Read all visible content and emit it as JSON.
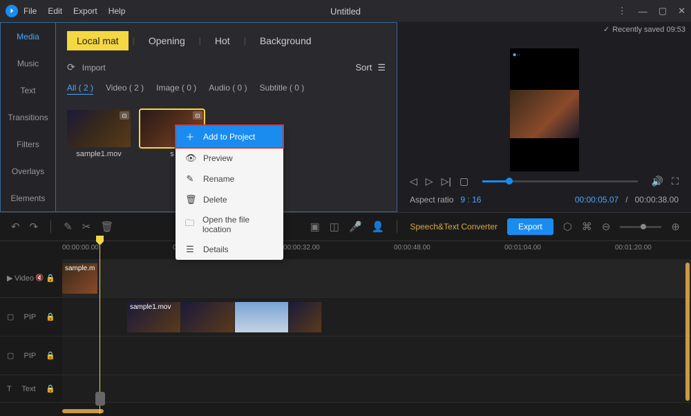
{
  "app": {
    "title": "Untitled",
    "menus": [
      "File",
      "Edit",
      "Export",
      "Help"
    ]
  },
  "status": {
    "saved": "Recently saved 09:53"
  },
  "sidebar": {
    "items": [
      "Media",
      "Music",
      "Text",
      "Transitions",
      "Filters",
      "Overlays",
      "Elements"
    ]
  },
  "tabs": {
    "local": "Local mat",
    "opening": "Opening",
    "hot": "Hot",
    "background": "Background"
  },
  "import": {
    "label": "Import",
    "sort": "Sort"
  },
  "filters": {
    "all": "All ( 2 )",
    "video": "Video ( 2 )",
    "image": "Image ( 0 )",
    "audio": "Audio ( 0 )",
    "subtitle": "Subtitle ( 0 )"
  },
  "media": {
    "items": [
      {
        "name": "sample1.mov"
      },
      {
        "name": "s"
      }
    ]
  },
  "ctx": {
    "add": "Add to Project",
    "preview": "Preview",
    "rename": "Rename",
    "delete": "Delete",
    "open": "Open the file location",
    "details": "Details"
  },
  "preview": {
    "aspect_label": "Aspect ratio",
    "aspect_val": "9 : 16",
    "time_cur": "00:00:05.07",
    "time_sep": "/",
    "time_total": "00:00:38.00"
  },
  "toolbar": {
    "speech": "Speech&Text Converter",
    "export": "Export"
  },
  "ruler": {
    "ticks": [
      "00:00:00.00",
      "00:00:16.00",
      "00:00:32.00",
      "00:00:48.00",
      "00:01:04.00",
      "00:01:20.00"
    ]
  },
  "tracks": {
    "video": "Video",
    "pip1": "PIP",
    "pip2": "PIP",
    "text": "Text",
    "clip1": "sample.m",
    "clip2": "sample1.mov"
  }
}
